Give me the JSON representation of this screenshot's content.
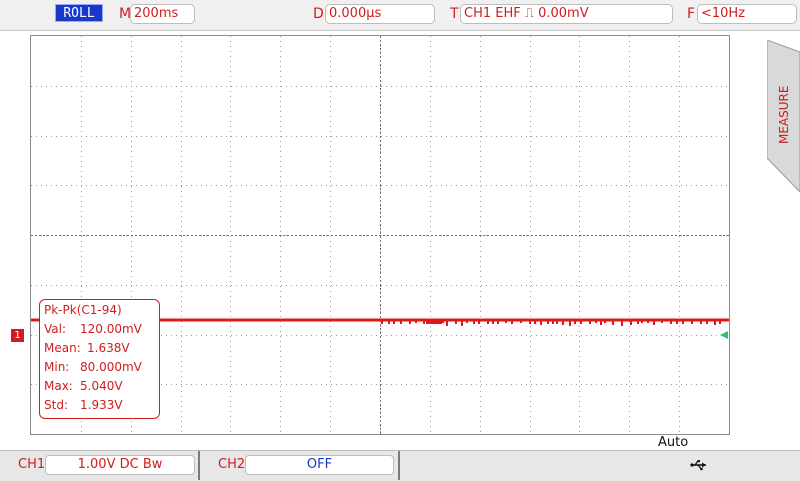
{
  "top": {
    "mode": "ROLL",
    "m_key": "M",
    "m_value": "200ms",
    "d_key": "D",
    "d_value": "0.000µs",
    "t_key": "T",
    "t_value": "CH1 EHF ⎍ 0.00mV",
    "f_key": "F",
    "f_value": "<10Hz"
  },
  "side": {
    "measure": "MEASURE"
  },
  "channel_marker": "1",
  "measure_panel": {
    "title": "Pk-Pk(C1-94)",
    "rows": [
      {
        "label": "Val:",
        "value": "120.00mV"
      },
      {
        "label": "Mean:",
        "value": "1.638V"
      },
      {
        "label": "Min:",
        "value": "80.000mV"
      },
      {
        "label": "Max:",
        "value": "5.040V"
      },
      {
        "label": "Std:",
        "value": "1.933V"
      }
    ]
  },
  "trigger_mode": "Auto",
  "bottom": {
    "ch1_label": "CH1",
    "ch1_value": "1.00V  DC  Bw",
    "ch2_label": "CH2",
    "ch2_value": "OFF"
  },
  "icons": {
    "usb": "usb-icon",
    "trigger_marker": "trigger-level-arrow-icon"
  },
  "colors": {
    "accent": "#d11d1d",
    "mode_badge": "#1a38c8",
    "trigger_marker": "#27c46b",
    "trace": "#e01818"
  }
}
